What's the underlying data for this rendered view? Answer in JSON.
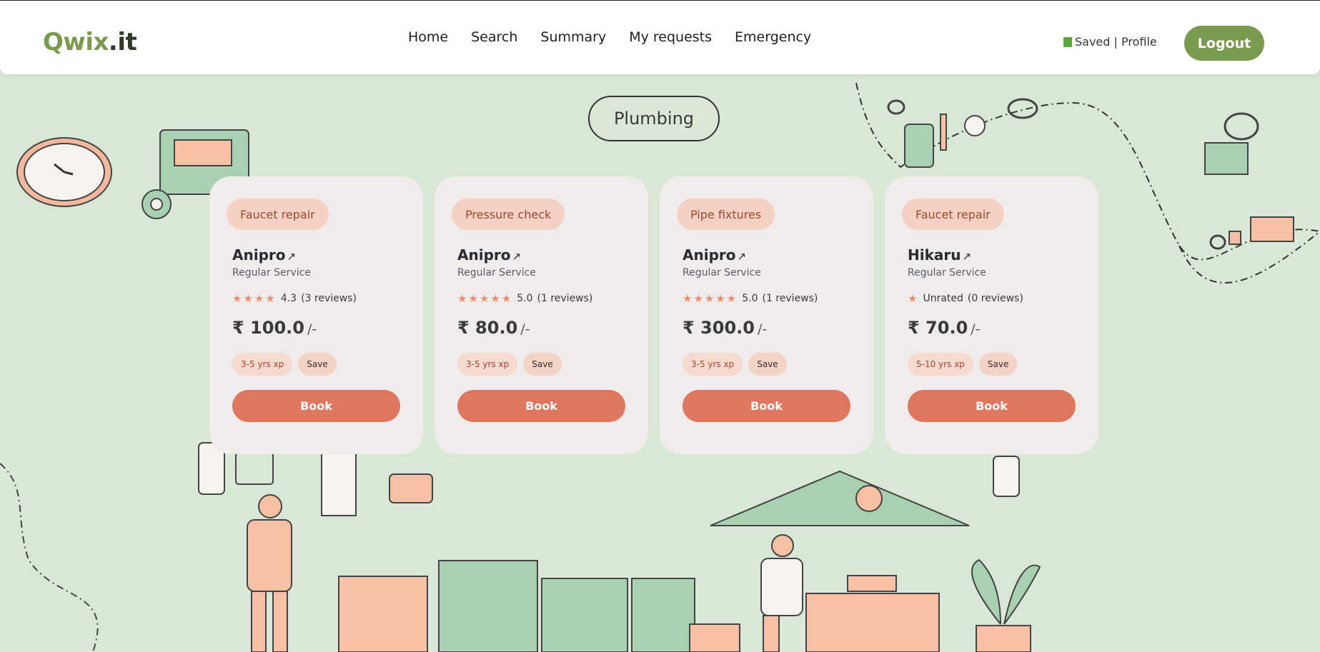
{
  "header": {
    "logo_main": "Qwix",
    "logo_suffix": ".it",
    "nav": [
      "Home",
      "Search",
      "Summary",
      "My requests",
      "Emergency"
    ],
    "saved_profile": "Saved | Profile",
    "logout": "Logout"
  },
  "category": "Plumbing",
  "cards": [
    {
      "tag": "Faucet repair",
      "name": "Anipro",
      "ext_icon": "↗",
      "type": "Regular Service",
      "stars": "★★★★",
      "rating": "4.3",
      "reviews": "(3 reviews)",
      "price": "₹ 100.0",
      "unit": "/-",
      "xp": "3-5 yrs xp",
      "save": "Save",
      "book": "Book"
    },
    {
      "tag": "Pressure check",
      "name": "Anipro",
      "ext_icon": "↗",
      "type": "Regular Service",
      "stars": "★★★★★",
      "rating": "5.0",
      "reviews": "(1 reviews)",
      "price": "₹ 80.0",
      "unit": "/-",
      "xp": "3-5 yrs xp",
      "save": "Save",
      "book": "Book"
    },
    {
      "tag": "Pipe fixtures",
      "name": "Anipro",
      "ext_icon": "↗",
      "type": "Regular Service",
      "stars": "★★★★★",
      "rating": "5.0",
      "reviews": "(1 reviews)",
      "price": "₹ 300.0",
      "unit": "/-",
      "xp": "3-5 yrs xp",
      "save": "Save",
      "book": "Book"
    },
    {
      "tag": "Faucet repair",
      "name": "Hikaru",
      "ext_icon": "↗",
      "type": "Regular Service",
      "stars": "★",
      "rating": "Unrated",
      "reviews": "(0 reviews)",
      "price": "₹ 70.0",
      "unit": "/-",
      "xp": "5-10 yrs xp",
      "save": "Save",
      "book": "Book"
    }
  ],
  "colors": {
    "brand_green": "#7a9a50",
    "book_button": "#df7760",
    "background": "#d9e8d6",
    "card": "#f0ecec"
  }
}
